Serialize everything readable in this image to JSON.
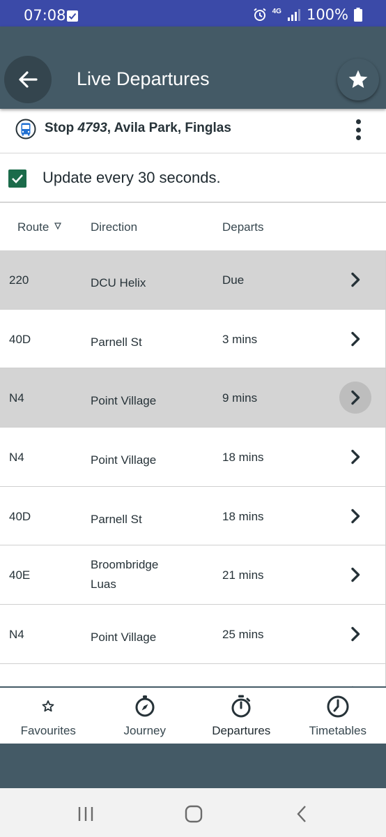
{
  "status_bar": {
    "time": "07:08",
    "network": "4G",
    "battery": "100%"
  },
  "app_bar": {
    "title": "Live Departures",
    "back_icon": "arrow-left-icon",
    "favourite_icon": "star-icon"
  },
  "stop": {
    "prefix": "Stop ",
    "number": "4793",
    "name": ", Avila Park, Finglas",
    "icon": "bus-icon"
  },
  "update": {
    "checked": true,
    "label": "Update every 30 seconds."
  },
  "table": {
    "headers": {
      "route": "Route",
      "direction": "Direction",
      "departs": "Departs"
    },
    "rows": [
      {
        "route": "220",
        "direction": "DCU Helix",
        "departs": "Due"
      },
      {
        "route": "40D",
        "direction": "Parnell St",
        "departs": "3 mins"
      },
      {
        "route": "N4",
        "direction": "Point Village",
        "departs": "9 mins"
      },
      {
        "route": "N4",
        "direction": "Point Village",
        "departs": "18 mins"
      },
      {
        "route": "40D",
        "direction": "Parnell St",
        "departs": "18 mins"
      },
      {
        "route": "40E",
        "direction": "Broombridge Luas",
        "departs": "21 mins"
      },
      {
        "route": "N4",
        "direction": "Point Village",
        "departs": "25 mins"
      },
      {
        "route": "",
        "direction": "",
        "departs": ""
      }
    ]
  },
  "bottom_nav": {
    "items": [
      {
        "label": "Favourites",
        "icon": "star-outline-icon"
      },
      {
        "label": "Journey",
        "icon": "compass-icon"
      },
      {
        "label": "Departures",
        "icon": "stopwatch-icon"
      },
      {
        "label": "Timetables",
        "icon": "clock-icon"
      }
    ],
    "active": "Departures"
  },
  "colors": {
    "status_bar": "#3b4aa8",
    "app_bar": "#445a66",
    "checkbox": "#1b6b4a",
    "row_shaded": "#d4d4d4"
  }
}
